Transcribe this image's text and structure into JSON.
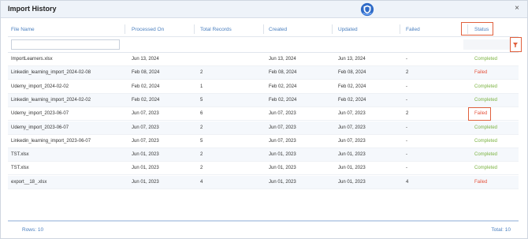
{
  "dialog": {
    "title": "Import History",
    "close_icon": "close-icon",
    "logo_icon": "shield-logo-icon"
  },
  "columns": {
    "file_name": "File Name",
    "processed_on": "Processed On",
    "total_records": "Total Records",
    "created": "Created",
    "updated": "Updated",
    "failed": "Failed",
    "status": "Status"
  },
  "filter": {
    "file_name_value": "",
    "icon": "filter-icon"
  },
  "rows": [
    {
      "file_name": "ImportLearners.xlsx",
      "processed_on": "Jun 13, 2024",
      "total_records": "",
      "created": "Jun 13, 2024",
      "updated": "Jun 13, 2024",
      "failed": "-",
      "status": "Completed"
    },
    {
      "file_name": "Linkedin_learning_import_2024-02-08",
      "processed_on": "Feb 08, 2024",
      "total_records": "2",
      "created": "Feb 08, 2024",
      "updated": "Feb 08, 2024",
      "failed": "2",
      "status": "Failed"
    },
    {
      "file_name": "Udemy_import_2024-02-02",
      "processed_on": "Feb 02, 2024",
      "total_records": "1",
      "created": "Feb 02, 2024",
      "updated": "Feb 02, 2024",
      "failed": "-",
      "status": "Completed"
    },
    {
      "file_name": "Linkedin_learning_import_2024-02-02",
      "processed_on": "Feb 02, 2024",
      "total_records": "5",
      "created": "Feb 02, 2024",
      "updated": "Feb 02, 2024",
      "failed": "-",
      "status": "Completed"
    },
    {
      "file_name": "Udemy_import_2023-06-07",
      "processed_on": "Jun 07, 2023",
      "total_records": "6",
      "created": "Jun 07, 2023",
      "updated": "Jun 07, 2023",
      "failed": "2",
      "status": "Failed"
    },
    {
      "file_name": "Udemy_import_2023-06-07",
      "processed_on": "Jun 07, 2023",
      "total_records": "2",
      "created": "Jun 07, 2023",
      "updated": "Jun 07, 2023",
      "failed": "-",
      "status": "Completed"
    },
    {
      "file_name": "Linkedin_learning_import_2023-06-07",
      "processed_on": "Jun 07, 2023",
      "total_records": "5",
      "created": "Jun 07, 2023",
      "updated": "Jun 07, 2023",
      "failed": "-",
      "status": "Completed"
    },
    {
      "file_name": "TST.xlsx",
      "processed_on": "Jun 01, 2023",
      "total_records": "2",
      "created": "Jun 01, 2023",
      "updated": "Jun 01, 2023",
      "failed": "-",
      "status": "Completed"
    },
    {
      "file_name": "TST.xlsx",
      "processed_on": "Jun 01, 2023",
      "total_records": "2",
      "created": "Jun 01, 2023",
      "updated": "Jun 01, 2023",
      "failed": "-",
      "status": "Completed"
    },
    {
      "file_name": "export__18_.xlsx",
      "processed_on": "Jun 01, 2023",
      "total_records": "4",
      "created": "Jun 01, 2023",
      "updated": "Jun 01, 2023",
      "failed": "4",
      "status": "Failed"
    }
  ],
  "footer": {
    "rows_label": "Rows: 10",
    "total_label": "Total: 10"
  },
  "colors": {
    "completed": "#7bb342",
    "failed": "#e5533d",
    "header_text": "#4a7fbf",
    "highlight": "#e0603d"
  }
}
